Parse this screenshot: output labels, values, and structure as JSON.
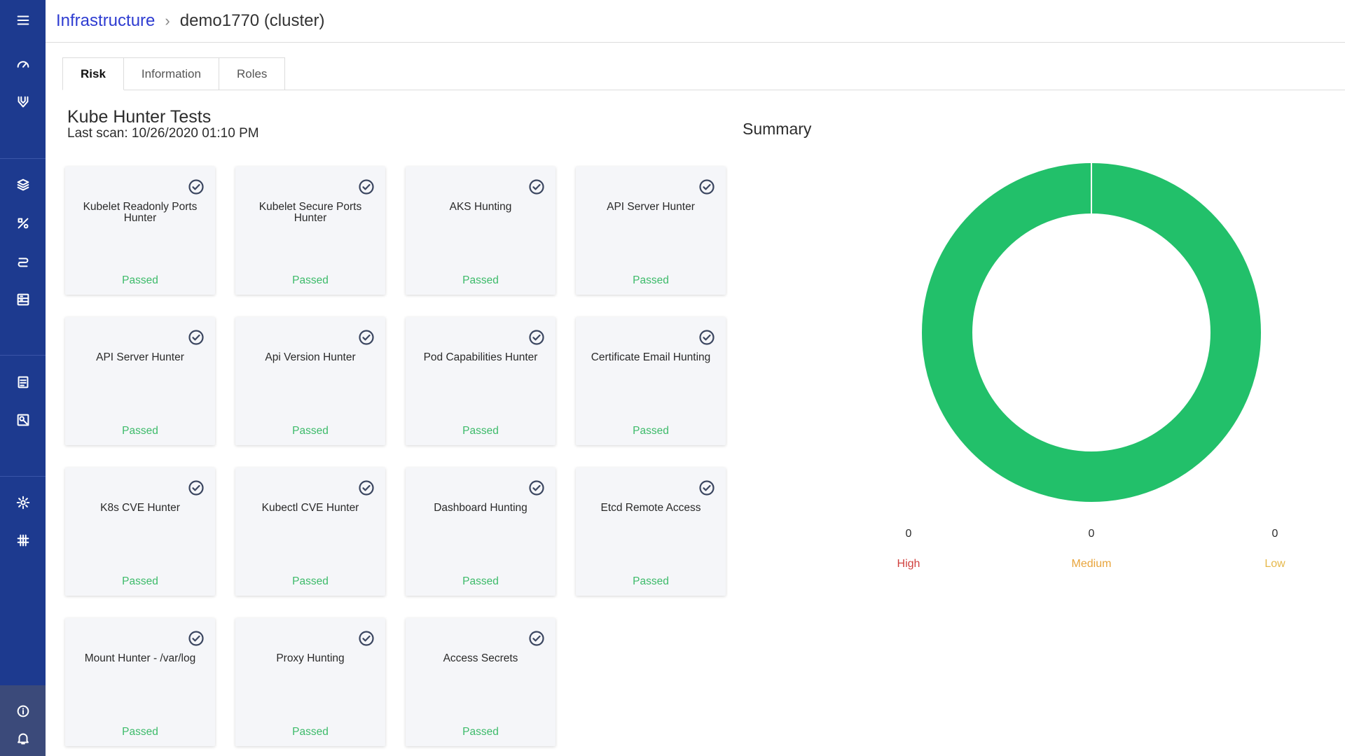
{
  "header": {
    "breadcrumb_root": "Infrastructure",
    "breadcrumb_separator": "›",
    "breadcrumb_current": "demo1770 (cluster)"
  },
  "tabs": [
    {
      "label": "Risk",
      "active": true
    },
    {
      "label": "Information",
      "active": false
    },
    {
      "label": "Roles",
      "active": false
    }
  ],
  "tests": {
    "title": "Kube Hunter Tests",
    "last_scan": "Last scan: 10/26/2020 01:10 PM",
    "cards": [
      {
        "name": "Kubelet Readonly Ports Hunter",
        "status": "Passed"
      },
      {
        "name": "Kubelet Secure Ports Hunter",
        "status": "Passed"
      },
      {
        "name": "AKS Hunting",
        "status": "Passed"
      },
      {
        "name": "API Server Hunter",
        "status": "Passed"
      },
      {
        "name": "API Server Hunter",
        "status": "Passed"
      },
      {
        "name": "Api Version Hunter",
        "status": "Passed"
      },
      {
        "name": "Pod Capabilities Hunter",
        "status": "Passed"
      },
      {
        "name": "Certificate Email Hunting",
        "status": "Passed"
      },
      {
        "name": "K8s CVE Hunter",
        "status": "Passed"
      },
      {
        "name": "Kubectl CVE Hunter",
        "status": "Passed"
      },
      {
        "name": "Dashboard Hunting",
        "status": "Passed"
      },
      {
        "name": "Etcd Remote Access",
        "status": "Passed"
      },
      {
        "name": "Mount Hunter - /var/log",
        "status": "Passed"
      },
      {
        "name": "Proxy Hunting",
        "status": "Passed"
      },
      {
        "name": "Access Secrets",
        "status": "Passed"
      }
    ]
  },
  "summary": {
    "title": "Summary",
    "high_value": "0",
    "high_label": "High",
    "medium_value": "0",
    "medium_label": "Medium",
    "low_value": "0",
    "low_label": "Low"
  },
  "chart_data": {
    "type": "pie",
    "categories": [
      "Passed"
    ],
    "values": [
      15
    ],
    "title": ""
  },
  "colors": {
    "sidebar": "#1d3a8f",
    "link": "#2e3cd1",
    "passed": "#3dbb6a",
    "donut": "#22c06a",
    "high": "#d0413e",
    "medium": "#e8a43b",
    "low": "#e6b84a"
  },
  "sidebar_icons": [
    "menu-icon",
    "dashboard-icon",
    "shield-icon",
    "layers-icon",
    "percent-icon",
    "link-icon",
    "storage-icon",
    "list-icon",
    "image-icon",
    "gear-icon",
    "grid-icon",
    "info-icon",
    "bell-icon"
  ]
}
